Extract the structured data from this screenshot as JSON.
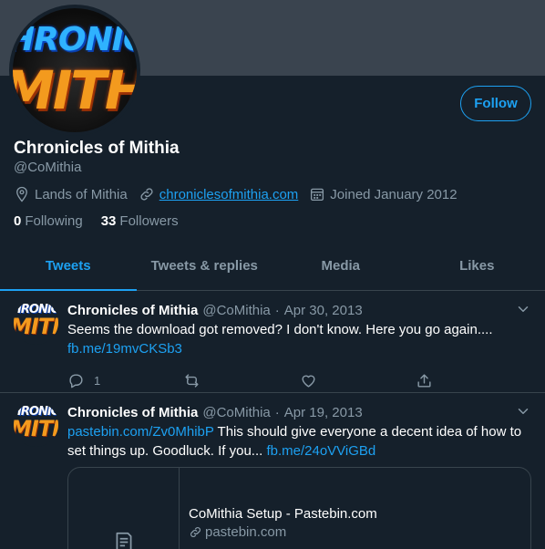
{
  "profile": {
    "name": "Chronicles of Mithia",
    "handle": "@CoMithia",
    "location": "Lands of Mithia",
    "website": "chroniclesofmithia.com",
    "joined": "Joined January 2012",
    "following_count": "0",
    "following_label": "Following",
    "followers_count": "33",
    "followers_label": "Followers",
    "follow_label": "Follow",
    "logo_top": "HRONICLES",
    "logo_bottom": "MITHI"
  },
  "mini_logo": {
    "top": "HRONICLES",
    "bottom": "MITHI"
  },
  "tabs": [
    {
      "label": "Tweets",
      "active": true
    },
    {
      "label": "Tweets & replies",
      "active": false
    },
    {
      "label": "Media",
      "active": false
    },
    {
      "label": "Likes",
      "active": false
    }
  ],
  "tweets": [
    {
      "name": "Chronicles of Mithia",
      "handle": "@CoMithia",
      "date": "Apr 30, 2013",
      "text": "Seems the download got removed? I don't know. Here you go again.... ",
      "link1": "fb.me/19mvCKSb3",
      "reply_count": "1"
    },
    {
      "name": "Chronicles of Mithia",
      "handle": "@CoMithia",
      "date": "Apr 19, 2013",
      "link_pre": "pastebin.com/Zv0MhibP",
      "text": " This should give everyone a decent idea of how to set things up. Goodluck. If you... ",
      "link1": "fb.me/24oVViGBd",
      "card_title": "CoMithia Setup - Pastebin.com",
      "card_domain": "pastebin.com"
    }
  ],
  "colors": {
    "accent": "#1da1f2",
    "background": "#15202b",
    "muted": "#8899a6",
    "banner": "#3a444f"
  }
}
